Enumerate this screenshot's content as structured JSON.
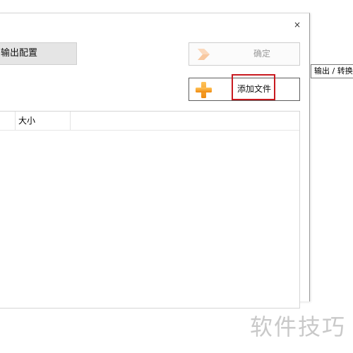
{
  "dialog": {
    "close_glyph": "×",
    "output_config_label": "输出配置",
    "confirm_label": "确定",
    "add_file_label": "添加文件"
  },
  "tooltip": {
    "text": "输出 / 转换"
  },
  "file_list": {
    "columns": [
      "",
      "大小"
    ]
  },
  "watermark": {
    "text": "软件技巧"
  },
  "icons": {
    "confirm": "arrow-right-icon",
    "add_file": "plus-icon",
    "close": "close-icon"
  },
  "colors": {
    "highlight": "#c8191f",
    "icon_orange": "#f39a1e",
    "disabled_text": "#9a9a9a"
  }
}
